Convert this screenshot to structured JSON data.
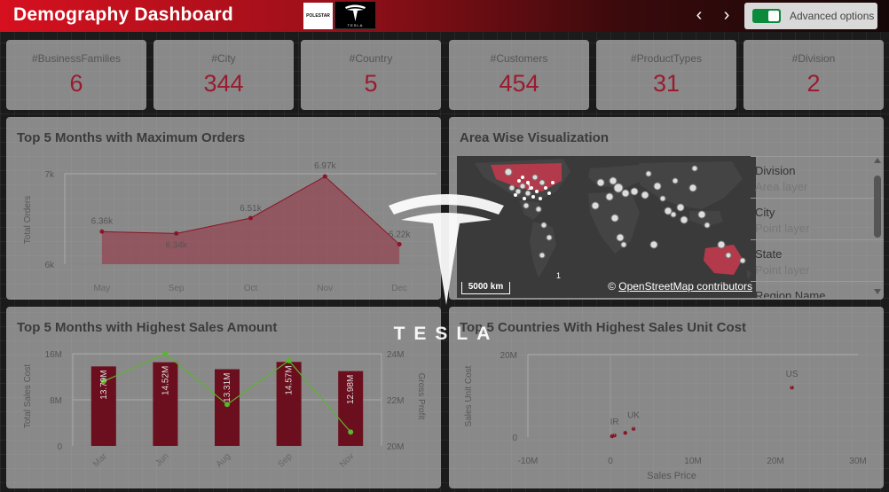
{
  "header": {
    "title": "Demography Dashboard",
    "logos": [
      "POLESTAR",
      "TESLA"
    ],
    "prev_icon": "‹",
    "next_icon": "›",
    "advanced_label": "Advanced options",
    "advanced_on": true,
    "colors": {
      "bar_start": "#d6101f",
      "bar_end": "#150708"
    }
  },
  "kpis": [
    {
      "label": "#BusinessFamilies",
      "value": "6"
    },
    {
      "label": "#City",
      "value": "344"
    },
    {
      "label": "#Country",
      "value": "5"
    },
    {
      "label": "#Customers",
      "value": "454"
    },
    {
      "label": "#ProductTypes",
      "value": "31"
    },
    {
      "label": "#Division",
      "value": "2"
    }
  ],
  "watermark": {
    "text": "TESLA"
  },
  "colors": {
    "accent": "#9a1b2e",
    "bar": "#6b0e1d",
    "line_green": "#5ab52e"
  },
  "orders_chart": {
    "title": "Top 5 Months with Maximum Orders",
    "chart_data": {
      "type": "area",
      "categories": [
        "May",
        "Sep",
        "Oct",
        "Nov",
        "Dec"
      ],
      "values": [
        6360,
        6340,
        6510,
        6970,
        6220
      ],
      "data_labels": [
        "6.36k",
        "6.34k",
        "6.51k",
        "6.97k",
        "6.22k"
      ],
      "ylabel": "Total Orders",
      "yticks": [
        "6k",
        "7k"
      ],
      "ylim": [
        6000,
        7000
      ]
    }
  },
  "sales_chart": {
    "title": "Top 5 Months with Highest Sales Amount",
    "chart_data": {
      "type": "bar",
      "categories": [
        "Mar",
        "Jun",
        "Aug",
        "Sep",
        "Nov"
      ],
      "series": [
        {
          "values": [
            13.79,
            14.52,
            13.31,
            14.57,
            12.98
          ],
          "labels": [
            "13.79M",
            "14.52M",
            "13.31M",
            "14.57M",
            "12.98M"
          ]
        },
        {
          "values": [
            22.8,
            24.0,
            21.8,
            23.7,
            20.6
          ]
        }
      ],
      "ylabel": "Total Sales Cost",
      "y2label": "Gross Profit",
      "ylim": [
        0,
        16
      ],
      "y2lim": [
        20,
        24
      ],
      "yticks": [
        "0",
        "8M",
        "16M"
      ],
      "y2ticks": [
        "20M",
        "22M",
        "24M"
      ]
    }
  },
  "map_panel": {
    "title": "Area Wise Visualization",
    "scale_label": "5000 km",
    "credit_prefix": "© ",
    "credit_link": "OpenStreetMap contributors",
    "cluster_labels": [
      "1",
      "1"
    ],
    "layers": [
      {
        "name": "Division",
        "type": "Area layer"
      },
      {
        "name": "City",
        "type": "Point layer"
      },
      {
        "name": "State",
        "type": "Point layer"
      },
      {
        "name": "Region Name",
        "type": ""
      }
    ]
  },
  "scatter_chart": {
    "title": "Top 5 Countries With Highest Sales Unit Cost",
    "chart_data": {
      "type": "scatter",
      "xlabel": "Sales Price",
      "ylabel": "Sales Unit Cost",
      "xticks": [
        "-10M",
        "0",
        "10M",
        "20M",
        "30M"
      ],
      "yticks": [
        "0",
        "20M"
      ],
      "xlim": [
        -10,
        30
      ],
      "ylim": [
        0,
        20
      ],
      "points": [
        {
          "label": "US",
          "x": 22.0,
          "y": 12.0
        },
        {
          "label": "IR",
          "x": 0.5,
          "y": 0.4
        },
        {
          "label": "",
          "x": 1.8,
          "y": 1.0
        },
        {
          "label": "UK",
          "x": 2.8,
          "y": 2.0
        },
        {
          "label": "",
          "x": 0.2,
          "y": 0.2
        }
      ]
    }
  }
}
